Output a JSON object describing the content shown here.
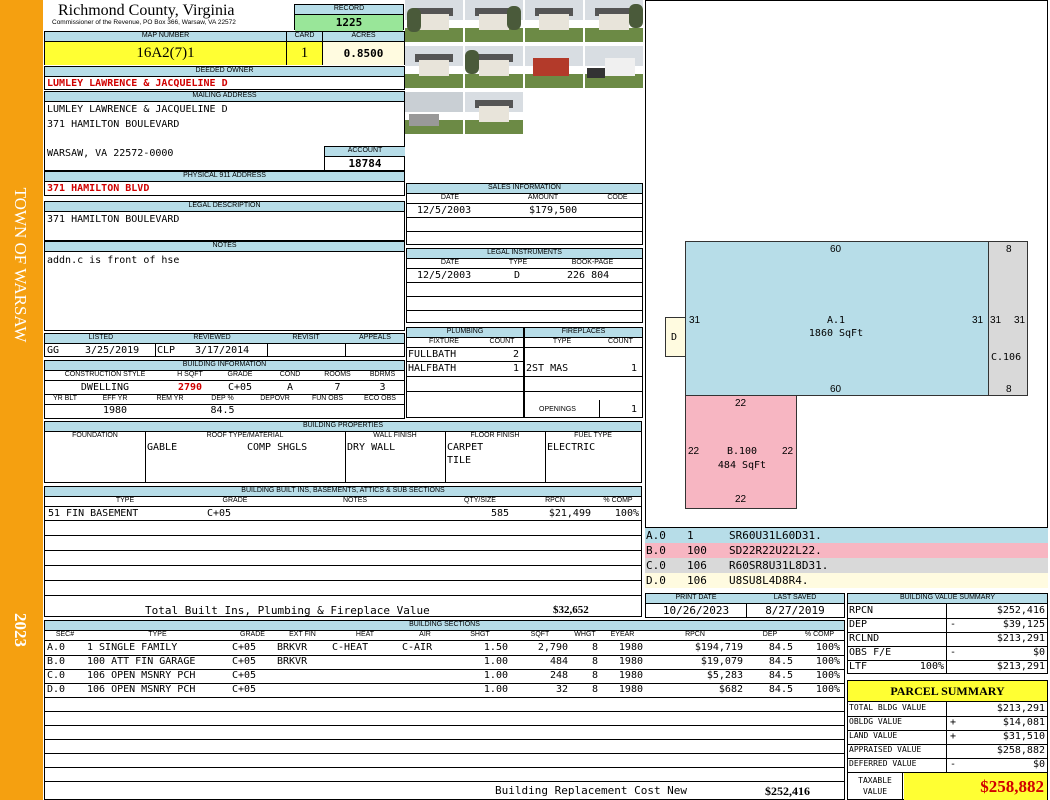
{
  "sidebar": {
    "town": "TOWN OF WARSAW",
    "year": "2023"
  },
  "header": {
    "county": "Richmond County, Virginia",
    "commissioner": "Commissioner of the Revenue, PO Box 366, Warsaw, VA 22572",
    "record_label": "RECORD",
    "record": "1225",
    "map_label": "MAP NUMBER",
    "map_number": "16A2(7)1",
    "card_label": "CARD",
    "card": "1",
    "acres_label": "ACRES",
    "acres": "0.8500"
  },
  "owner": {
    "deeded_label": "DEEDED OWNER",
    "deeded": "LUMLEY LAWRENCE & JACQUELINE D",
    "mailing_label": "MAILING ADDRESS",
    "mail1": "LUMLEY LAWRENCE & JACQUELINE D",
    "mail2": "371 HAMILTON BOULEVARD",
    "mail3": "WARSAW, VA 22572-0000",
    "account_label": "ACCOUNT",
    "account": "18784",
    "physical_label": "PHYSICAL 911 ADDRESS",
    "physical": "371 HAMILTON BLVD",
    "legal_label": "LEGAL DESCRIPTION",
    "legal": "371 HAMILTON BOULEVARD",
    "notes_label": "NOTES",
    "notes": "addn.c is front of hse"
  },
  "sales": {
    "title": "SALES INFORMATION",
    "h_date": "DATE",
    "h_amount": "AMOUNT",
    "h_code": "CODE",
    "date": "12/5/2003",
    "amount": "$179,500",
    "code": ""
  },
  "legal_instruments": {
    "title": "LEGAL INSTRUMENTS",
    "h_date": "DATE",
    "h_type": "TYPE",
    "h_book": "BOOK-PAGE",
    "date": "12/5/2003",
    "type": "D",
    "book": "226 804"
  },
  "plumbing": {
    "title": "PLUMBING",
    "h_fixture": "FIXTURE",
    "h_count": "COUNT",
    "rows": [
      {
        "fixture": "FULLBATH",
        "count": "2"
      },
      {
        "fixture": "HALFBATH",
        "count": "1"
      }
    ]
  },
  "fireplaces": {
    "title": "FIREPLACES",
    "h_type": "TYPE",
    "h_count": "COUNT",
    "type": "2ST MAS",
    "count": "1",
    "openings_label": "OPENINGS",
    "openings": "1"
  },
  "listing": {
    "h_listed": "LISTED",
    "h_reviewed": "REVIEWED",
    "h_revisit": "REVISIT",
    "h_appeals": "APPEALS",
    "listed_by": "GG",
    "listed": "3/25/2019",
    "reviewed_by": "CLP",
    "reviewed": "3/17/2014"
  },
  "building_info": {
    "title": "BUILDING INFORMATION",
    "h_style": "CONSTRUCTION STYLE",
    "h_hsqft": "H SQFT",
    "h_grade": "GRADE",
    "h_cond": "COND",
    "h_rooms": "ROOMS",
    "h_bdrms": "BDRMS",
    "style": "DWELLING",
    "hsqft": "2790",
    "grade": "C+05",
    "cond": "A",
    "rooms": "7",
    "bdrms": "3",
    "h_yrblt": "YR BLT",
    "h_effyr": "EFF YR",
    "h_remyr": "REM YR",
    "h_dep": "DEP %",
    "h_depovr": "DEPOVR",
    "h_funobs": "FUN OBS",
    "h_ecoobs": "ECO OBS",
    "effyr": "1980",
    "dep": "84.5"
  },
  "building_props": {
    "title": "BUILDING PROPERTIES",
    "h_foundation": "FOUNDATION",
    "h_roof": "ROOF TYPE/MATERIAL",
    "h_wall": "WALL FINISH",
    "h_floor": "FLOOR FINISH",
    "h_fuel": "FUEL TYPE",
    "roof_type": "GABLE",
    "roof_mat": "COMP SHGLS",
    "wall": "DRY WALL",
    "floor1": "CARPET",
    "floor2": "TILE",
    "fuel": "ELECTRIC"
  },
  "builtins": {
    "title": "BUILDING BUILT INS, BASEMENTS, ATTICS & SUB SECTIONS",
    "h_type": "TYPE",
    "h_grade": "GRADE",
    "h_notes": "NOTES",
    "h_qty": "QTY/SIZE",
    "h_rpcn": "RPCN",
    "h_comp": "% COMP",
    "type": "51 FIN BASEMENT",
    "grade": "C+05",
    "qty": "585",
    "rpcn": "$21,499",
    "comp": "100%",
    "total_label": "Total Built Ins, Plumbing & Fireplace Value",
    "total": "$32,652"
  },
  "sketch": {
    "labels": [
      {
        "id": "A.1",
        "area": "1860 SqFt"
      },
      {
        "id": "B.100",
        "area": "484 SqFt"
      },
      {
        "id": "C.106",
        "area": ""
      },
      {
        "id": "D",
        "area": ""
      }
    ],
    "dims": {
      "a_top": "60",
      "a_bottom": "60",
      "a_left": "31",
      "a_right": "31",
      "c_top": "8",
      "c_bottom": "8",
      "c_left": "31",
      "c_right": "31",
      "b_top": "22",
      "b_bottom": "22",
      "b_left": "22",
      "b_right": "22"
    },
    "legend": [
      {
        "sec": "A.0",
        "code": "1",
        "desc": "SR60U31L60D31.",
        "color": "#b7dde8"
      },
      {
        "sec": "B.0",
        "code": "100",
        "desc": "SD22R22U22L22.",
        "color": "#f7b6c2"
      },
      {
        "sec": "C.0",
        "code": "106",
        "desc": "R60SR8U31L8D31.",
        "color": "#d9d9d9"
      },
      {
        "sec": "D.0",
        "code": "106",
        "desc": "U8SU8L4D8R4.",
        "color": "#fffbe0"
      }
    ]
  },
  "print": {
    "h_print": "PRINT DATE",
    "h_saved": "LAST SAVED",
    "print_date": "10/26/2023",
    "last_saved": "8/27/2019"
  },
  "sections": {
    "title": "BUILDING SECTIONS",
    "headers": [
      "SEC#",
      "TYPE",
      "GRADE",
      "EXT FIN",
      "HEAT",
      "AIR",
      "SHGT",
      "SQFT",
      "WHGT",
      "EYEAR",
      "RPCN",
      "DEP",
      "% COMP"
    ],
    "rows": [
      [
        "A.0",
        "1 SINGLE FAMILY",
        "C+05",
        "BRKVR",
        "C-HEAT",
        "C-AIR",
        "1.50",
        "2,790",
        "8",
        "1980",
        "$194,719",
        "84.5",
        "100%"
      ],
      [
        "B.0",
        "100 ATT FIN GARAGE",
        "C+05",
        "BRKVR",
        "",
        "",
        "1.00",
        "484",
        "8",
        "1980",
        "$19,079",
        "84.5",
        "100%"
      ],
      [
        "C.0",
        "106 OPEN MSNRY PCH",
        "C+05",
        "",
        "",
        "",
        "1.00",
        "248",
        "8",
        "1980",
        "$5,283",
        "84.5",
        "100%"
      ],
      [
        "D.0",
        "106 OPEN MSNRY PCH",
        "C+05",
        "",
        "",
        "",
        "1.00",
        "32",
        "8",
        "1980",
        "$682",
        "84.5",
        "100%"
      ]
    ],
    "replacement_label": "Building Replacement Cost New",
    "replacement": "$252,416"
  },
  "value_summary": {
    "title": "BUILDING VALUE SUMMARY",
    "rpcn_label": "RPCN",
    "rpcn": "$252,416",
    "dep_label": "DEP",
    "dep_sign": "-",
    "dep": "$39,125",
    "rclnd_label": "RCLND",
    "rclnd": "$213,291",
    "obs_label": "OBS F/E",
    "obs_sign": "-",
    "obs": "$0",
    "ltf_label": "LTF",
    "ltf_pct": "100%",
    "ltf": "$213,291"
  },
  "parcel": {
    "title": "PARCEL SUMMARY",
    "bldg_label": "TOTAL BLDG VALUE",
    "bldg": "$213,291",
    "obldg_label": "OBLDG VALUE",
    "obldg_sign": "+",
    "obldg": "$14,081",
    "land_label": "LAND VALUE",
    "land_sign": "+",
    "land": "$31,510",
    "appraised_label": "APPRAISED VALUE",
    "appraised": "$258,882",
    "deferred_label": "DEFERRED VALUE",
    "deferred_sign": "-",
    "deferred": "$0",
    "taxable_label1": "TAXABLE",
    "taxable_label2": "VALUE",
    "taxable": "$258,882"
  },
  "colors": {
    "sidebar": "#f5a010",
    "header_blue": "#b7dde8",
    "yellow": "#ffff33",
    "green": "#99e699"
  }
}
